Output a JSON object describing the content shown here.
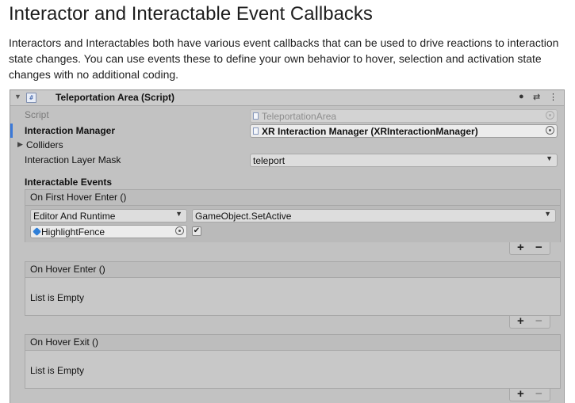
{
  "doc": {
    "title": "Interactor and Interactable Event Callbacks",
    "paragraph": "Interactors and Interactables both have various event callbacks that can be used to drive reactions to interaction state changes. You can use events these to define your own behavior to hover, selection and activation state changes with no additional coding."
  },
  "inspector": {
    "component_title": "Teleportation Area (Script)",
    "script_label": "Script",
    "script_value": "TeleportationArea",
    "manager_label": "Interaction Manager",
    "manager_value": "XR Interaction Manager (XRInteractionManager)",
    "colliders_label": "Colliders",
    "layer_mask_label": "Interaction Layer Mask",
    "layer_mask_value": "teleport",
    "events_heading": "Interactable Events",
    "events": [
      {
        "name": "On First Hover Enter ()",
        "runtime": "Editor And Runtime",
        "function": "GameObject.SetActive",
        "target": "HighlightFence",
        "checked": true
      },
      {
        "name": "On Hover Enter ()",
        "empty_text": "List is Empty"
      },
      {
        "name": "On Hover Exit ()",
        "empty_text": "List is Empty"
      }
    ]
  },
  "icons": {
    "fold": "▼",
    "help": "❓",
    "settings": "⇄",
    "more": "⋮",
    "expand": "▶",
    "dropdown": "▼",
    "plus": "+",
    "minus": "−",
    "check": "✔"
  }
}
